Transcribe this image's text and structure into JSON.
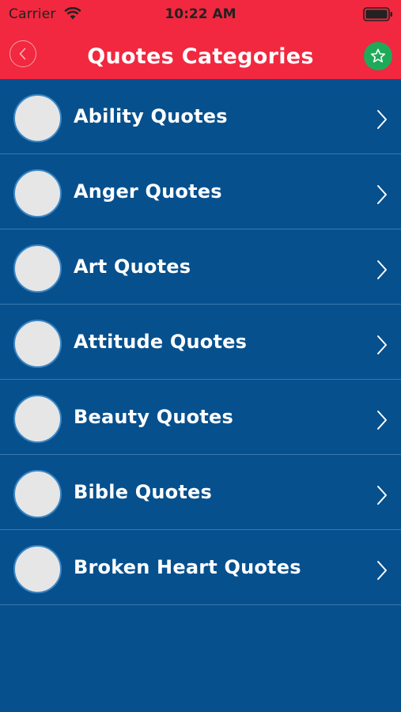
{
  "status_bar": {
    "carrier": "Carrier",
    "time": "10:22 AM"
  },
  "nav": {
    "title": "Quotes Categories"
  },
  "categories": [
    {
      "label": "Ability Quotes"
    },
    {
      "label": "Anger Quotes"
    },
    {
      "label": "Art Quotes"
    },
    {
      "label": "Attitude Quotes"
    },
    {
      "label": "Beauty Quotes"
    },
    {
      "label": "Bible Quotes"
    },
    {
      "label": "Broken Heart Quotes"
    }
  ],
  "colors": {
    "header": "#f1283f",
    "background": "#06508e",
    "favorite": "#1faa5a"
  }
}
